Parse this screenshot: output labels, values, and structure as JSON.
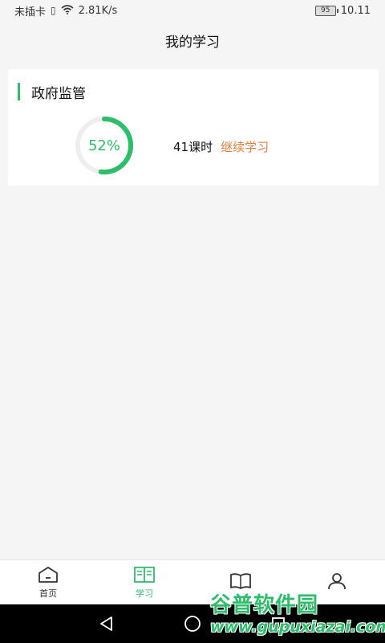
{
  "status_bar": {
    "carrier": "未插卡",
    "speed": "2.81K/s",
    "battery": "95",
    "time": "10.11"
  },
  "header": {
    "title": "我的学习"
  },
  "course": {
    "title": "政府监管",
    "progress_percent": 52,
    "progress_label": "52%",
    "hours": "41课时",
    "continue_label": "继续学习"
  },
  "tabs": [
    {
      "label": "首页",
      "icon": "home-icon",
      "active": false
    },
    {
      "label": "学习",
      "icon": "open-book-icon",
      "active": true
    },
    {
      "label": "",
      "icon": "book-icon",
      "active": false
    },
    {
      "label": "",
      "icon": "user-icon",
      "active": false
    }
  ],
  "watermark": {
    "name": "谷普软件园",
    "url": "www.gupuxiazai.com"
  },
  "colors": {
    "accent": "#2dbd6b",
    "link": "#e07e3c",
    "ring_track": "#eeeeee"
  }
}
